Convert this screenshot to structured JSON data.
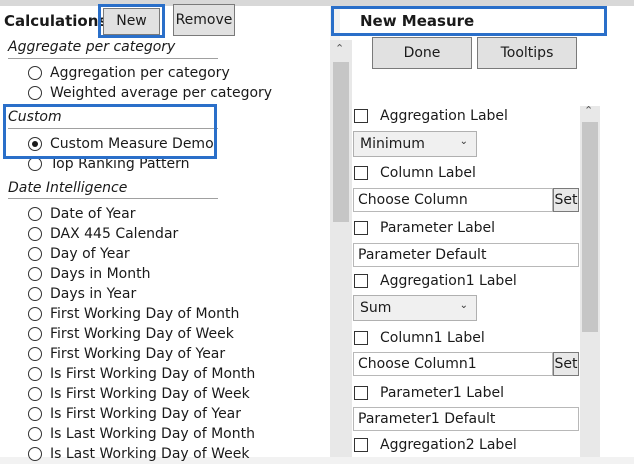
{
  "toolbar": {
    "title": "Calculations",
    "new_label": "New",
    "remove_label": "Remove"
  },
  "right_header": {
    "title": "New Measure",
    "done_label": "Done",
    "tooltips_label": "Tooltips"
  },
  "groups": [
    {
      "title": "Aggregate per category",
      "items": [
        "Aggregation per category",
        "Weighted average per category"
      ]
    },
    {
      "title": "Custom",
      "items": [
        "Custom Measure Demo",
        "Top Ranking Pattern"
      ]
    },
    {
      "title": "Date Intelligence",
      "items": [
        "Date of Year",
        "DAX 445 Calendar",
        "Day of Year",
        "Days in Month",
        "Days in Year",
        "First Working Day of Month",
        "First Working Day of Week",
        "First Working Day of Year",
        "Is First Working Day of Month",
        "Is First Working Day of Week",
        "Is First Working Day of Year",
        "Is Last Working Day of Month",
        "Is Last Working Day of Week"
      ]
    }
  ],
  "selected_item": "Custom Measure Demo",
  "form": {
    "aggregation_label": "Aggregation Label",
    "aggregation_value": "Minimum",
    "column_label": "Column Label",
    "column_placeholder": "Choose Column",
    "set_label": "Set",
    "parameter_label": "Parameter Label",
    "parameter_value": "Parameter Default",
    "aggregation1_label": "Aggregation1 Label",
    "aggregation1_value": "Sum",
    "column1_label": "Column1 Label",
    "column1_placeholder": "Choose Column1",
    "parameter1_label": "Parameter1 Label",
    "parameter1_value": "Parameter1 Default",
    "aggregation2_label": "Aggregation2 Label"
  },
  "colors": {
    "highlight": "#2a6fc9"
  }
}
